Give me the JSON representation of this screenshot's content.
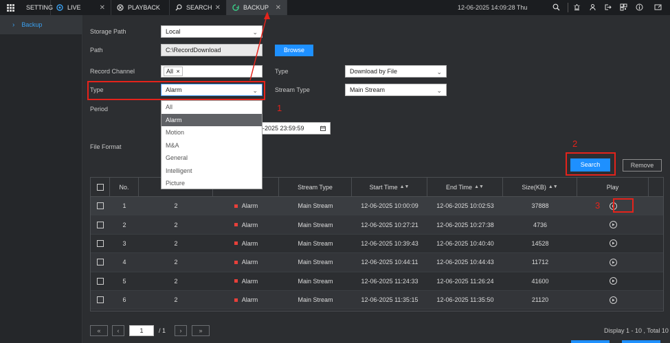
{
  "topbar": {
    "setting_label": "SETTING",
    "tabs": [
      {
        "label": "LIVE"
      },
      {
        "label": "PLAYBACK"
      },
      {
        "label": "SEARCH"
      },
      {
        "label": "BACKUP"
      }
    ],
    "datetime": "12-06-2025 14:09:28 Thu",
    "icons": [
      "search-icon",
      "alarm-icon",
      "user-icon",
      "logout-icon",
      "qr-icon",
      "info-icon",
      "fullscreen-icon"
    ]
  },
  "sidebar": {
    "items": [
      {
        "label": "Backup"
      }
    ]
  },
  "form": {
    "storage_path_label": "Storage Path",
    "storage_path_value": "Local",
    "path_label": "Path",
    "path_value": "C:\\RecordDownload",
    "browse_label": "Browse",
    "record_channel_label": "Record Channel",
    "record_channel_value": "All",
    "type_right_label": "Type",
    "type_right_value": "Download by File",
    "type_label": "Type",
    "type_value": "Alarm",
    "stream_type_label": "Stream Type",
    "stream_type_value": "Main Stream",
    "period_label": "Period",
    "period_end_value": "-2025 23:59:59",
    "file_format_label": "File Format",
    "search_label": "Search",
    "remove_label": "Remove"
  },
  "type_dropdown": {
    "options": [
      "All",
      "Alarm",
      "Motion",
      "M&A",
      "General",
      "Intelligent",
      "Picture"
    ],
    "selected": "Alarm"
  },
  "annotations": {
    "n1": "1",
    "n2": "2",
    "n3": "3",
    "color": "#e5231b"
  },
  "table": {
    "headers": {
      "no": "No.",
      "stream_type": "Stream Type",
      "start_time": "Start Time",
      "end_time": "End Time",
      "size": "Size(KB)",
      "play": "Play"
    },
    "rows": [
      {
        "no": "1",
        "channel": "2",
        "type": "Alarm",
        "stream": "Main Stream",
        "start": "12-06-2025 10:00:09",
        "end": "12-06-2025 10:02:53",
        "size": "37888"
      },
      {
        "no": "2",
        "channel": "2",
        "type": "Alarm",
        "stream": "Main Stream",
        "start": "12-06-2025 10:27:21",
        "end": "12-06-2025 10:27:38",
        "size": "4736"
      },
      {
        "no": "3",
        "channel": "2",
        "type": "Alarm",
        "stream": "Main Stream",
        "start": "12-06-2025 10:39:43",
        "end": "12-06-2025 10:40:40",
        "size": "14528"
      },
      {
        "no": "4",
        "channel": "2",
        "type": "Alarm",
        "stream": "Main Stream",
        "start": "12-06-2025 10:44:11",
        "end": "12-06-2025 10:44:43",
        "size": "11712"
      },
      {
        "no": "5",
        "channel": "2",
        "type": "Alarm",
        "stream": "Main Stream",
        "start": "12-06-2025 11:24:33",
        "end": "12-06-2025 11:26:24",
        "size": "41600"
      },
      {
        "no": "6",
        "channel": "2",
        "type": "Alarm",
        "stream": "Main Stream",
        "start": "12-06-2025 11:35:15",
        "end": "12-06-2025 11:35:50",
        "size": "21120"
      }
    ]
  },
  "pagination": {
    "current_page": "1",
    "total_pages": "/ 1",
    "display_text": "Display 1 - 10 , Total 10"
  },
  "colors": {
    "accent": "#1e90ff",
    "highlight": "#e5231b",
    "alarm_marker": "#e8403a"
  }
}
